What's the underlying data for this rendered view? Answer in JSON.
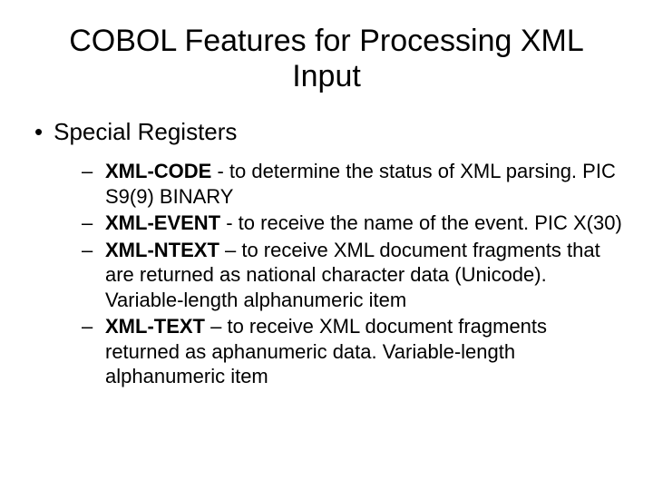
{
  "title": "COBOL Features for Processing XML Input",
  "level1": {
    "bullet": "•",
    "text": "Special Registers"
  },
  "items": [
    {
      "dash": "–",
      "bold": "XML-CODE",
      "rest": "  - to determine the status of XML parsing. PIC S9(9) BINARY"
    },
    {
      "dash": "–",
      "bold": "XML-EVENT",
      "rest": " - to receive the name of the event. PIC X(30)"
    },
    {
      "dash": "–",
      "bold": "XML-NTEXT",
      "rest": " – to receive XML document fragments that are returned as national character data (Unicode). Variable-length alphanumeric item"
    },
    {
      "dash": "–",
      "bold": "XML-TEXT",
      "rest": " – to receive XML document fragments returned as aphanumeric data. Variable-length alphanumeric item"
    }
  ]
}
